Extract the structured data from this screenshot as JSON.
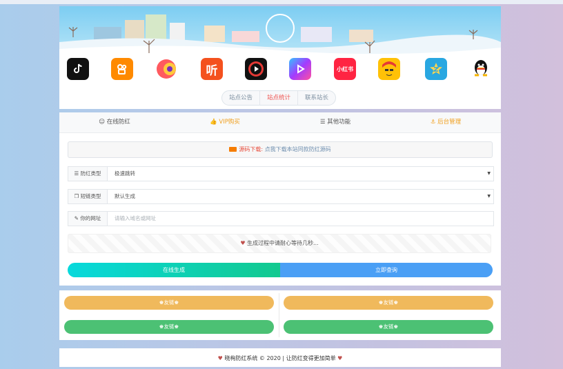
{
  "header": {
    "apps": [
      {
        "icon": "tiktok-icon",
        "color": "#111111"
      },
      {
        "icon": "kuaishou-icon",
        "color": "#ff8a00"
      },
      {
        "icon": "quanmin-k-song-icon",
        "color": "#ff5a5f"
      },
      {
        "icon": "ting-icon",
        "color": "#f4511e",
        "text": "听"
      },
      {
        "icon": "video-play-icon",
        "color": "#e53935"
      },
      {
        "icon": "weishi-icon",
        "color": "#8e44ff"
      },
      {
        "icon": "xiaohongshu-icon",
        "color": "#ff2442",
        "text": "小红书"
      },
      {
        "icon": "cartoon-face-icon",
        "color": "#ffc107"
      },
      {
        "icon": "qzone-icon",
        "color": "#29a7e1"
      },
      {
        "icon": "qq-penguin-icon",
        "color": "#ffffff"
      }
    ],
    "pills": [
      "站点公告",
      "站点统计",
      "联系站长"
    ]
  },
  "tabs": [
    {
      "icon": "smile-icon",
      "glyph": "☺",
      "label": "在线防红"
    },
    {
      "icon": "thumb-up-icon",
      "glyph": "👍",
      "label": "VIP购买"
    },
    {
      "icon": "list-icon",
      "glyph": "☰",
      "label": "其他功能"
    },
    {
      "icon": "anchor-icon",
      "glyph": "⚓",
      "label": "后台管理"
    }
  ],
  "notice": {
    "prefix": "源码下载:",
    "link": "点我下载本站同款防红源码"
  },
  "form": {
    "type_label": "防红类型",
    "type_value": "极速跳转",
    "short_label": "短链类型",
    "short_value": "默认生成",
    "url_label": "你的网址",
    "url_placeholder": "请输入域名或网址"
  },
  "progress_text": "生成过程中请耐心等待几秒...",
  "buttons": {
    "generate": "在线生成",
    "query": "立即查询"
  },
  "friend_links": [
    "友链",
    "友链",
    "友链",
    "友链"
  ],
  "footer": {
    "text": "晓栒防红系统 © 2020 | 让防红变得更加简单"
  },
  "colors": {
    "orange_btn": "#f0b95c",
    "green_btn": "#4cc174",
    "blue_btn": "#4a9ff5",
    "accent_red": "#ef5350"
  }
}
